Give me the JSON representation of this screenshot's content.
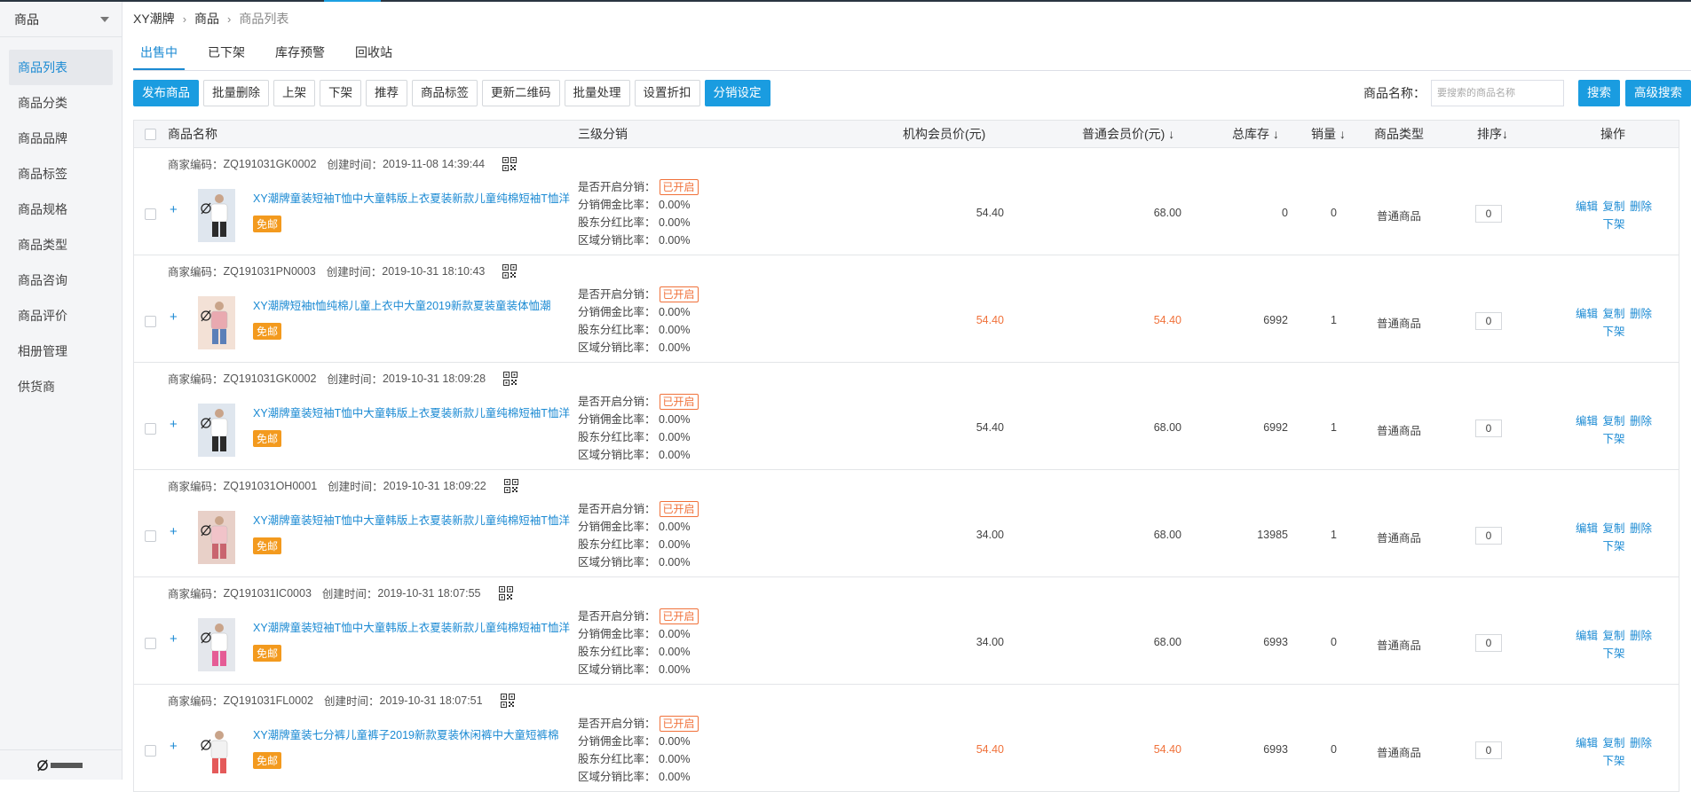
{
  "sidebar": {
    "header": "商品",
    "items": [
      {
        "label": "商品列表",
        "active": true
      },
      {
        "label": "商品分类"
      },
      {
        "label": "商品品牌"
      },
      {
        "label": "商品标签"
      },
      {
        "label": "商品规格"
      },
      {
        "label": "商品类型"
      },
      {
        "label": "商品咨询"
      },
      {
        "label": "商品评价"
      },
      {
        "label": "相册管理"
      },
      {
        "label": "供货商"
      }
    ]
  },
  "breadcrumb": [
    "XY潮牌",
    "商品",
    "商品列表"
  ],
  "tabs": [
    "出售中",
    "已下架",
    "库存预警",
    "回收站"
  ],
  "toolbar": {
    "buttons": [
      "发布商品",
      "批量删除",
      "上架",
      "下架",
      "推荐",
      "商品标签",
      "更新二维码",
      "批量处理",
      "设置折扣",
      "分销设定"
    ],
    "search_label": "商品名称：",
    "search_placeholder": "要搜索的商品名称",
    "search_button": "搜索",
    "advanced_button": "高级搜索"
  },
  "table": {
    "headers": {
      "name": "商品名称",
      "distribution": "三级分销",
      "org_price": "机构会员价(元)",
      "normal_price": "普通会员价(元) ↓",
      "stock": "总库存 ↓",
      "sales": "销量 ↓",
      "type": "商品类型",
      "sort": "排序↓",
      "ops": "操作"
    },
    "labels": {
      "merchant_code": "商家编码：",
      "created": "创建时间：",
      "free_shipping": "免邮",
      "dist_enabled": "是否开启分销：",
      "dist_enabled_value": "已开启",
      "commission": "分销佣金比率：",
      "shareholder": "股东分红比率：",
      "region": "区域分销比率：",
      "edit": "编辑",
      "copy": "复制",
      "delete": "删除",
      "offshelf": "下架"
    },
    "rows": [
      {
        "code": "ZQ191031GK0002",
        "created": "2019-11-08 14:39:44",
        "name": "XY潮牌童装短袖T恤中大童韩版上衣夏装新款儿童纯棉短袖T恤洋",
        "commission": "0.00%",
        "shareholder": "0.00%",
        "region": "0.00%",
        "org_price": "54.40",
        "normal_price": "68.00",
        "stock": "0",
        "sales": "0",
        "type": "普通商品",
        "sort": "0",
        "highlight": false
      },
      {
        "code": "ZQ191031PN0003",
        "created": "2019-10-31 18:10:43",
        "name": "XY潮牌短袖t恤纯棉儿童上衣中大童2019新款夏装童装体恤潮",
        "commission": "0.00%",
        "shareholder": "0.00%",
        "region": "0.00%",
        "org_price": "54.40",
        "normal_price": "54.40",
        "stock": "6992",
        "sales": "1",
        "type": "普通商品",
        "sort": "0",
        "highlight": true
      },
      {
        "code": "ZQ191031GK0002",
        "created": "2019-10-31 18:09:28",
        "name": "XY潮牌童装短袖T恤中大童韩版上衣夏装新款儿童纯棉短袖T恤洋",
        "commission": "0.00%",
        "shareholder": "0.00%",
        "region": "0.00%",
        "org_price": "54.40",
        "normal_price": "68.00",
        "stock": "6992",
        "sales": "1",
        "type": "普通商品",
        "sort": "0",
        "highlight": false
      },
      {
        "code": "ZQ191031OH0001",
        "created": "2019-10-31 18:09:22",
        "name": "XY潮牌童装短袖T恤中大童韩版上衣夏装新款儿童纯棉短袖T恤洋",
        "commission": "0.00%",
        "shareholder": "0.00%",
        "region": "0.00%",
        "org_price": "34.00",
        "normal_price": "68.00",
        "stock": "13985",
        "sales": "1",
        "type": "普通商品",
        "sort": "0",
        "highlight": false
      },
      {
        "code": "ZQ191031IC0003",
        "created": "2019-10-31 18:07:55",
        "name": "XY潮牌童装短袖T恤中大童韩版上衣夏装新款儿童纯棉短袖T恤洋",
        "commission": "0.00%",
        "shareholder": "0.00%",
        "region": "0.00%",
        "org_price": "34.00",
        "normal_price": "68.00",
        "stock": "6993",
        "sales": "0",
        "type": "普通商品",
        "sort": "0",
        "highlight": false
      },
      {
        "code": "ZQ191031FL0002",
        "created": "2019-10-31 18:07:51",
        "name": "XY潮牌童装七分裤儿童裤子2019新款夏装休闲裤中大童短裤棉",
        "commission": "0.00%",
        "shareholder": "0.00%",
        "region": "0.00%",
        "org_price": "54.40",
        "normal_price": "54.40",
        "stock": "6993",
        "sales": "0",
        "type": "普通商品",
        "sort": "0",
        "highlight": true
      }
    ]
  },
  "colors": {
    "accent": "#1a9ce0",
    "link": "#1b8ad3",
    "highlight_price": "#f0713a",
    "free_badge": "#f39a1e"
  }
}
